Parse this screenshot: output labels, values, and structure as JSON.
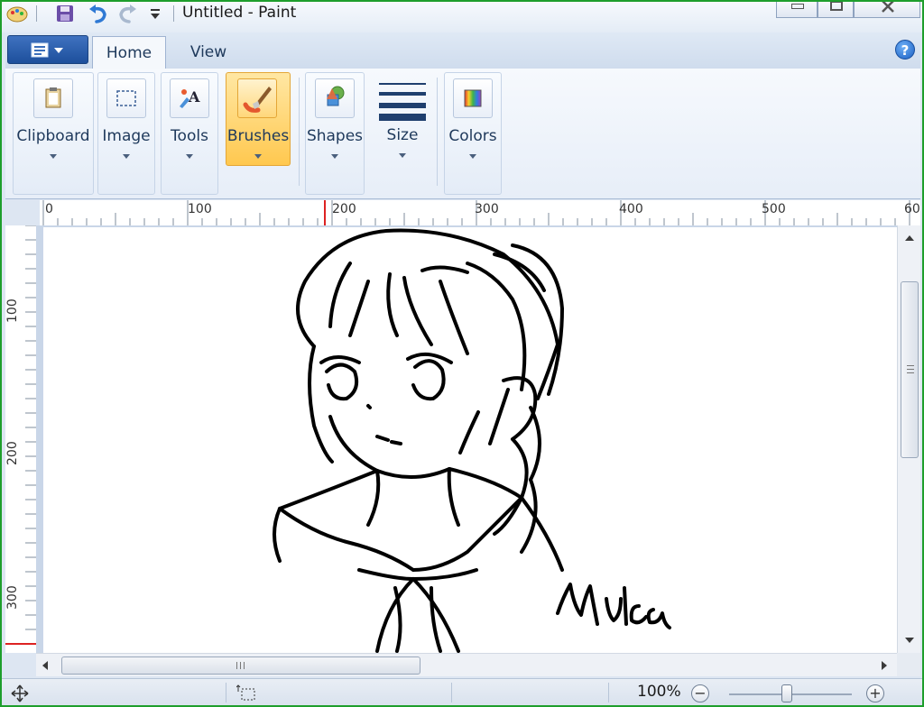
{
  "window": {
    "title": "Untitled - Paint"
  },
  "tabs": {
    "home": "Home",
    "view": "View"
  },
  "help": {
    "glyph": "?"
  },
  "ribbon": {
    "groups": [
      {
        "label": "Clipboard",
        "icon": "clipboard-icon"
      },
      {
        "label": "Image",
        "icon": "select-icon"
      },
      {
        "label": "Tools",
        "icon": "tools-icon"
      },
      {
        "label": "Brushes",
        "icon": "brush-icon",
        "active": true
      },
      {
        "label": "Shapes",
        "icon": "shapes-icon"
      },
      {
        "label": "Size",
        "icon": "line-size-icon"
      },
      {
        "label": "Colors",
        "icon": "colors-icon"
      }
    ]
  },
  "rulers": {
    "horizontal": [
      "0",
      "100",
      "200",
      "300",
      "400",
      "500",
      "60"
    ],
    "vertical": [
      "100",
      "200",
      "300"
    ]
  },
  "canvas": {
    "signature": "Mika"
  },
  "status": {
    "zoom": "100%",
    "zoom_minus": "−",
    "zoom_plus": "+"
  },
  "colors": {
    "accent": "#ffc84f",
    "frame": "#1e9e2c",
    "ribbon": "#e7eef8"
  }
}
